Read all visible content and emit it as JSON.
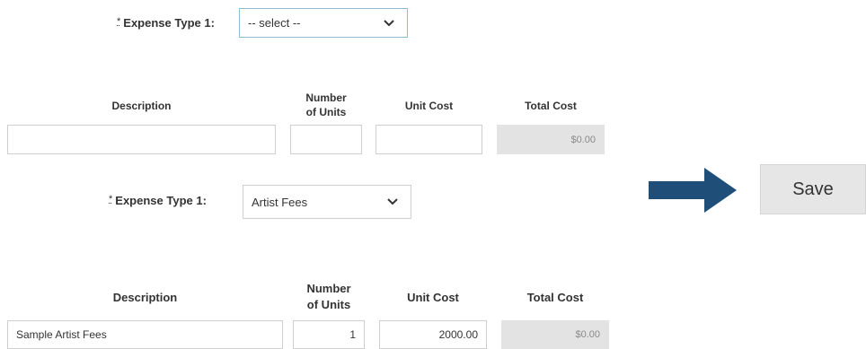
{
  "section1": {
    "expense_label": "Expense Type 1:",
    "required_mark": "*",
    "select_value": "-- select --",
    "headers": {
      "description": "Description",
      "units_line1": "Number",
      "units_line2": "of Units",
      "unit_cost": "Unit Cost",
      "total_cost": "Total Cost"
    },
    "row": {
      "description": "",
      "units": "",
      "unit_cost": "",
      "total_cost": "$0.00"
    }
  },
  "section2": {
    "expense_label": "Expense Type 1:",
    "required_mark": "*",
    "select_value": "Artist Fees",
    "headers": {
      "description": "Description",
      "units_line1": "Number",
      "units_line2": "of Units",
      "unit_cost": "Unit Cost",
      "total_cost": "Total Cost"
    },
    "row": {
      "description": "Sample Artist Fees",
      "units": "1",
      "unit_cost": "2000.00",
      "total_cost": "$0.00"
    }
  },
  "save_button": {
    "label": "Save"
  },
  "arrow": {
    "icon": "arrow-right-icon",
    "color": "#1f4e79"
  }
}
